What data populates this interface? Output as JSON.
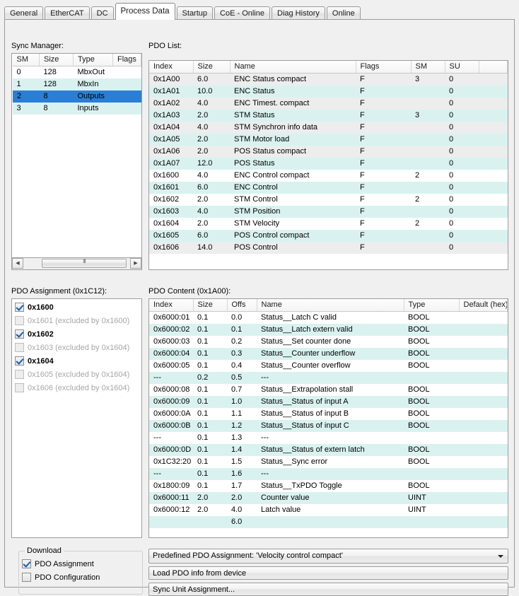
{
  "tabs": [
    {
      "label": "General",
      "active": false
    },
    {
      "label": "EtherCAT",
      "active": false
    },
    {
      "label": "DC",
      "active": false
    },
    {
      "label": "Process Data",
      "active": true
    },
    {
      "label": "Startup",
      "active": false
    },
    {
      "label": "CoE - Online",
      "active": false
    },
    {
      "label": "Diag History",
      "active": false
    },
    {
      "label": "Online",
      "active": false
    }
  ],
  "sync_manager": {
    "label": "Sync Manager:",
    "columns": [
      "SM",
      "Size",
      "Type",
      "Flags"
    ],
    "rows": [
      {
        "sm": "0",
        "size": "128",
        "type": "MbxOut",
        "flags": "",
        "style": "alt-white"
      },
      {
        "sm": "1",
        "size": "128",
        "type": "MbxIn",
        "flags": "",
        "style": "alt-cyan"
      },
      {
        "sm": "2",
        "size": "8",
        "type": "Outputs",
        "flags": "",
        "style": "selected"
      },
      {
        "sm": "3",
        "size": "8",
        "type": "Inputs",
        "flags": "",
        "style": "alt-cyan"
      }
    ]
  },
  "pdo_list": {
    "label": "PDO List:",
    "columns": [
      "Index",
      "Size",
      "Name",
      "Flags",
      "SM",
      "SU",
      ""
    ],
    "rows": [
      {
        "index": "0x1A00",
        "size": "6.0",
        "name": "ENC Status compact",
        "flags": "F",
        "sm": "3",
        "su": "0",
        "style": "alt-gray"
      },
      {
        "index": "0x1A01",
        "size": "10.0",
        "name": "ENC Status",
        "flags": "F",
        "sm": "",
        "su": "0",
        "style": "alt-cyan"
      },
      {
        "index": "0x1A02",
        "size": "4.0",
        "name": "ENC Timest. compact",
        "flags": "F",
        "sm": "",
        "su": "0",
        "style": "alt-gray"
      },
      {
        "index": "0x1A03",
        "size": "2.0",
        "name": "STM Status",
        "flags": "F",
        "sm": "3",
        "su": "0",
        "style": "alt-cyan"
      },
      {
        "index": "0x1A04",
        "size": "4.0",
        "name": "STM Synchron info data",
        "flags": "F",
        "sm": "",
        "su": "0",
        "style": "alt-gray"
      },
      {
        "index": "0x1A05",
        "size": "2.0",
        "name": "STM Motor load",
        "flags": "F",
        "sm": "",
        "su": "0",
        "style": "alt-cyan"
      },
      {
        "index": "0x1A06",
        "size": "2.0",
        "name": "POS Status compact",
        "flags": "F",
        "sm": "",
        "su": "0",
        "style": "alt-gray"
      },
      {
        "index": "0x1A07",
        "size": "12.0",
        "name": "POS Status",
        "flags": "F",
        "sm": "",
        "su": "0",
        "style": "alt-cyan"
      },
      {
        "index": "0x1600",
        "size": "4.0",
        "name": "ENC Control compact",
        "flags": "F",
        "sm": "2",
        "su": "0",
        "style": "alt-white"
      },
      {
        "index": "0x1601",
        "size": "6.0",
        "name": "ENC Control",
        "flags": "F",
        "sm": "",
        "su": "0",
        "style": "alt-cyan"
      },
      {
        "index": "0x1602",
        "size": "2.0",
        "name": "STM Control",
        "flags": "F",
        "sm": "2",
        "su": "0",
        "style": "alt-white"
      },
      {
        "index": "0x1603",
        "size": "4.0",
        "name": "STM Position",
        "flags": "F",
        "sm": "",
        "su": "0",
        "style": "alt-cyan"
      },
      {
        "index": "0x1604",
        "size": "2.0",
        "name": "STM Velocity",
        "flags": "F",
        "sm": "2",
        "su": "0",
        "style": "alt-white"
      },
      {
        "index": "0x1605",
        "size": "6.0",
        "name": "POS Control compact",
        "flags": "F",
        "sm": "",
        "su": "0",
        "style": "alt-cyan"
      },
      {
        "index": "0x1606",
        "size": "14.0",
        "name": "POS Control",
        "flags": "F",
        "sm": "",
        "su": "0",
        "style": "alt-gray"
      }
    ]
  },
  "pdo_assignment": {
    "label": "PDO Assignment (0x1C12):",
    "items": [
      {
        "label": "0x1600",
        "checked": true,
        "enabled": true
      },
      {
        "label": "0x1601 (excluded by 0x1600)",
        "checked": false,
        "enabled": false
      },
      {
        "label": "0x1602",
        "checked": true,
        "enabled": true
      },
      {
        "label": "0x1603 (excluded by 0x1604)",
        "checked": false,
        "enabled": false
      },
      {
        "label": "0x1604",
        "checked": true,
        "enabled": true
      },
      {
        "label": "0x1605 (excluded by 0x1604)",
        "checked": false,
        "enabled": false
      },
      {
        "label": "0x1606 (excluded by 0x1604)",
        "checked": false,
        "enabled": false
      }
    ]
  },
  "pdo_content": {
    "label": "PDO Content (0x1A00):",
    "columns": [
      "Index",
      "Size",
      "Offs",
      "Name",
      "Type",
      "Default (hex)"
    ],
    "rows": [
      {
        "index": "0x6000:01",
        "size": "0.1",
        "offs": "0.0",
        "name": "Status__Latch C valid",
        "type": "BOOL",
        "default": "",
        "style": "alt-white"
      },
      {
        "index": "0x6000:02",
        "size": "0.1",
        "offs": "0.1",
        "name": "Status__Latch extern valid",
        "type": "BOOL",
        "default": "",
        "style": "alt-cyan"
      },
      {
        "index": "0x6000:03",
        "size": "0.1",
        "offs": "0.2",
        "name": "Status__Set counter done",
        "type": "BOOL",
        "default": "",
        "style": "alt-white"
      },
      {
        "index": "0x6000:04",
        "size": "0.1",
        "offs": "0.3",
        "name": "Status__Counter underflow",
        "type": "BOOL",
        "default": "",
        "style": "alt-cyan"
      },
      {
        "index": "0x6000:05",
        "size": "0.1",
        "offs": "0.4",
        "name": "Status__Counter overflow",
        "type": "BOOL",
        "default": "",
        "style": "alt-white"
      },
      {
        "index": "---",
        "size": "0.2",
        "offs": "0.5",
        "name": "---",
        "type": "",
        "default": "",
        "style": "alt-cyan"
      },
      {
        "index": "0x6000:08",
        "size": "0.1",
        "offs": "0.7",
        "name": "Status__Extrapolation stall",
        "type": "BOOL",
        "default": "",
        "style": "alt-white"
      },
      {
        "index": "0x6000:09",
        "size": "0.1",
        "offs": "1.0",
        "name": "Status__Status of input A",
        "type": "BOOL",
        "default": "",
        "style": "alt-cyan"
      },
      {
        "index": "0x6000:0A",
        "size": "0.1",
        "offs": "1.1",
        "name": "Status__Status of input B",
        "type": "BOOL",
        "default": "",
        "style": "alt-white"
      },
      {
        "index": "0x6000:0B",
        "size": "0.1",
        "offs": "1.2",
        "name": "Status__Status of input C",
        "type": "BOOL",
        "default": "",
        "style": "alt-cyan"
      },
      {
        "index": "---",
        "size": "0.1",
        "offs": "1.3",
        "name": "---",
        "type": "",
        "default": "",
        "style": "alt-white"
      },
      {
        "index": "0x6000:0D",
        "size": "0.1",
        "offs": "1.4",
        "name": "Status__Status of extern latch",
        "type": "BOOL",
        "default": "",
        "style": "alt-cyan"
      },
      {
        "index": "0x1C32:20",
        "size": "0.1",
        "offs": "1.5",
        "name": "Status__Sync error",
        "type": "BOOL",
        "default": "",
        "style": "alt-white"
      },
      {
        "index": "---",
        "size": "0.1",
        "offs": "1.6",
        "name": "---",
        "type": "",
        "default": "",
        "style": "alt-cyan"
      },
      {
        "index": "0x1800:09",
        "size": "0.1",
        "offs": "1.7",
        "name": "Status__TxPDO Toggle",
        "type": "BOOL",
        "default": "",
        "style": "alt-white"
      },
      {
        "index": "0x6000:11",
        "size": "2.0",
        "offs": "2.0",
        "name": "Counter value",
        "type": "UINT",
        "default": "",
        "style": "alt-cyan"
      },
      {
        "index": "0x6000:12",
        "size": "2.0",
        "offs": "4.0",
        "name": "Latch value",
        "type": "UINT",
        "default": "",
        "style": "alt-white"
      },
      {
        "index": "",
        "size": "",
        "offs": "6.0",
        "name": "",
        "type": "",
        "default": "",
        "style": "alt-cyan"
      }
    ]
  },
  "download": {
    "title": "Download",
    "items": [
      {
        "label": "PDO Assignment",
        "checked": true
      },
      {
        "label": "PDO Configuration",
        "checked": false
      }
    ]
  },
  "actions": {
    "predefined_pdo_assignment": "Predefined PDO Assignment: 'Velocity control compact'",
    "load_pdo_info": "Load PDO info from device",
    "sync_unit_assignment": "Sync Unit Assignment..."
  }
}
